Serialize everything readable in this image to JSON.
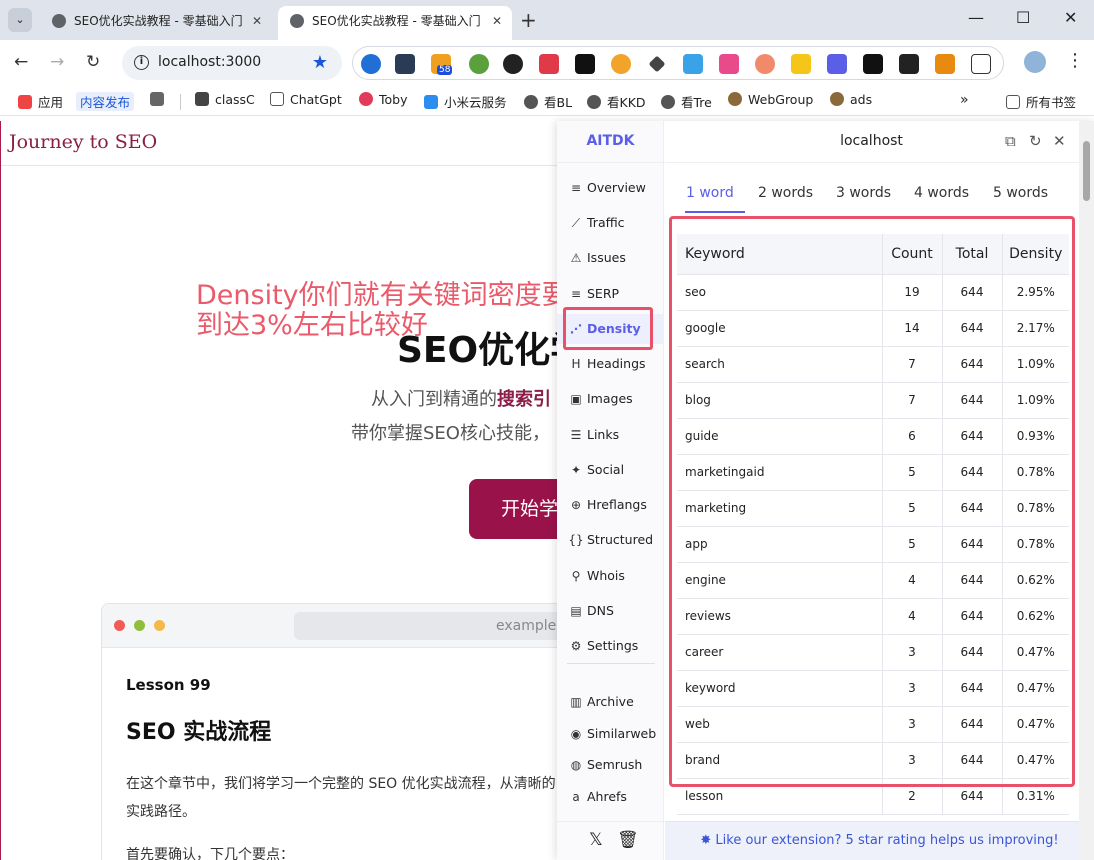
{
  "browser": {
    "tabs": [
      {
        "title": "SEO优化实战教程 - 零基础入门",
        "active": false
      },
      {
        "title": "SEO优化实战教程 - 零基础入门",
        "active": true
      }
    ],
    "url": "localhost:3000",
    "bookmarks": [
      "应用",
      "内容发布",
      "classC",
      "ChatGpt",
      "Toby",
      "小米云服务",
      "看BL",
      "看KKD",
      "看Tre",
      "WebGroup",
      "ads",
      "所有书签"
    ],
    "ext_badge": "58"
  },
  "page": {
    "site_title": "Journey to SEO",
    "annotation": "Density你们就有关键词密度要到达3%左右比较好",
    "hero_title": "SEO优化学",
    "hero_sub1_prefix": "从入门到精通的",
    "hero_sub1_highlight": "搜索引",
    "hero_sub2": "带你掌握SEO核心技能，",
    "cta": "开始学习",
    "card_url": "example.com",
    "lesson_number": "Lesson 99",
    "lesson_title": "SEO 实战流程",
    "lesson_paragraph": "在这个章节中，我们将学习一个完整的 SEO 优化实战流程，从清晰的实践路径。",
    "lesson_paragraph2": "首先要确认，下几个要点："
  },
  "extension": {
    "brand": "AITDK",
    "host": "localhost",
    "sidebar": [
      {
        "label": "Overview",
        "icon": "≡"
      },
      {
        "label": "Traffic",
        "icon": "⟋"
      },
      {
        "label": "Issues",
        "icon": "⚠"
      },
      {
        "label": "SERP",
        "icon": "≡"
      },
      {
        "label": "Density",
        "icon": "⋰"
      },
      {
        "label": "Headings",
        "icon": "H"
      },
      {
        "label": "Images",
        "icon": "▣"
      },
      {
        "label": "Links",
        "icon": "☰"
      },
      {
        "label": "Social",
        "icon": "✦"
      },
      {
        "label": "Hreflangs",
        "icon": "⊕"
      },
      {
        "label": "Structured",
        "icon": "{}"
      },
      {
        "label": "Whois",
        "icon": "⚲"
      },
      {
        "label": "DNS",
        "icon": "▤"
      },
      {
        "label": "Settings",
        "icon": "⚙"
      }
    ],
    "sidebar_extra": [
      {
        "label": "Archive",
        "icon": "▥"
      },
      {
        "label": "Similarweb",
        "icon": "◉"
      },
      {
        "label": "Semrush",
        "icon": "◍"
      },
      {
        "label": "Ahrefs",
        "icon": "a"
      }
    ],
    "word_tabs": [
      "1 word",
      "2 words",
      "3 words",
      "4 words",
      "5 words"
    ],
    "table_headers": {
      "keyword": "Keyword",
      "count": "Count",
      "total": "Total",
      "density": "Density"
    },
    "rows": [
      {
        "keyword": "seo",
        "count": "19",
        "total": "644",
        "density": "2.95%"
      },
      {
        "keyword": "google",
        "count": "14",
        "total": "644",
        "density": "2.17%"
      },
      {
        "keyword": "search",
        "count": "7",
        "total": "644",
        "density": "1.09%"
      },
      {
        "keyword": "blog",
        "count": "7",
        "total": "644",
        "density": "1.09%"
      },
      {
        "keyword": "guide",
        "count": "6",
        "total": "644",
        "density": "0.93%"
      },
      {
        "keyword": "marketingaid",
        "count": "5",
        "total": "644",
        "density": "0.78%"
      },
      {
        "keyword": "marketing",
        "count": "5",
        "total": "644",
        "density": "0.78%"
      },
      {
        "keyword": "app",
        "count": "5",
        "total": "644",
        "density": "0.78%"
      },
      {
        "keyword": "engine",
        "count": "4",
        "total": "644",
        "density": "0.62%"
      },
      {
        "keyword": "reviews",
        "count": "4",
        "total": "644",
        "density": "0.62%"
      },
      {
        "keyword": "career",
        "count": "3",
        "total": "644",
        "density": "0.47%"
      },
      {
        "keyword": "keyword",
        "count": "3",
        "total": "644",
        "density": "0.47%"
      },
      {
        "keyword": "web",
        "count": "3",
        "total": "644",
        "density": "0.47%"
      },
      {
        "keyword": "brand",
        "count": "3",
        "total": "644",
        "density": "0.47%"
      },
      {
        "keyword": "lesson",
        "count": "2",
        "total": "644",
        "density": "0.31%"
      }
    ],
    "footer": "Like our extension? 5 star rating helps us improving!"
  }
}
